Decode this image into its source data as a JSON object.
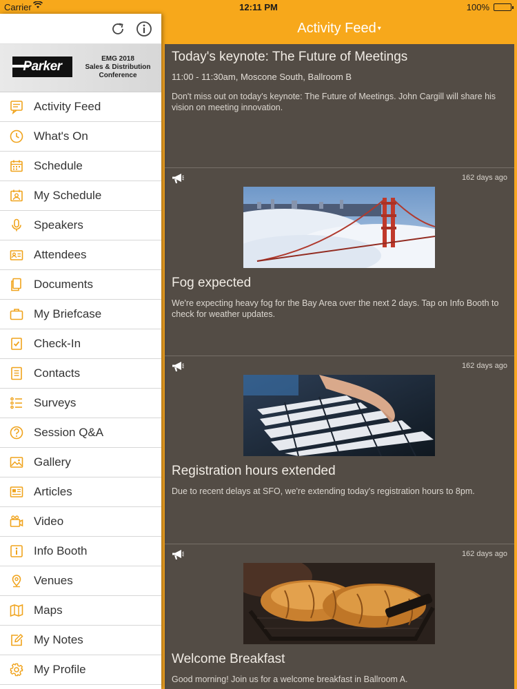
{
  "status_bar": {
    "carrier": "Carrier",
    "time": "12:11 PM",
    "battery": "100%",
    "battery_level": 1.0
  },
  "header": {
    "title": "Activity Feed",
    "caret": "▾"
  },
  "sidebar": {
    "toolbar": {
      "refresh_icon": "refresh-icon",
      "info_icon": "info-icon"
    },
    "banner": {
      "logo_text": "Parker",
      "line1": "EMG 2018",
      "line2": "Sales & Distribution",
      "line3": "Conference"
    },
    "items": [
      {
        "label": "Activity Feed",
        "icon": "feed-icon"
      },
      {
        "label": "What's On",
        "icon": "clock-icon"
      },
      {
        "label": "Schedule",
        "icon": "calendar-icon"
      },
      {
        "label": "My Schedule",
        "icon": "user-calendar-icon"
      },
      {
        "label": "Speakers",
        "icon": "microphone-icon"
      },
      {
        "label": "Attendees",
        "icon": "id-card-icon"
      },
      {
        "label": "Documents",
        "icon": "documents-icon"
      },
      {
        "label": "My Briefcase",
        "icon": "briefcase-icon"
      },
      {
        "label": "Check-In",
        "icon": "checkbox-icon"
      },
      {
        "label": "Contacts",
        "icon": "contacts-icon"
      },
      {
        "label": "Surveys",
        "icon": "list-icon"
      },
      {
        "label": "Session Q&A",
        "icon": "question-icon"
      },
      {
        "label": "Gallery",
        "icon": "image-icon"
      },
      {
        "label": "Articles",
        "icon": "newspaper-icon"
      },
      {
        "label": "Video",
        "icon": "video-icon"
      },
      {
        "label": "Info Booth",
        "icon": "info-box-icon"
      },
      {
        "label": "Venues",
        "icon": "location-pin-icon"
      },
      {
        "label": "Maps",
        "icon": "map-icon"
      },
      {
        "label": "My Notes",
        "icon": "pencil-icon"
      },
      {
        "label": "My Profile",
        "icon": "gear-icon"
      }
    ]
  },
  "feed": [
    {
      "title": "Today's keynote: The Future of Meetings",
      "subtitle": "11:00 - 11:30am, Moscone South, Ballroom B",
      "body": "Don't miss out on today's keynote: The Future of Meetings. John Cargill will share his vision on meeting innovation."
    },
    {
      "time_ago": "162 days ago",
      "image": "golden-gate-bridge-fog-photo",
      "title": "Fog expected",
      "body": "We're expecting heavy fog for the Bay Area over the next 2 days. Tap on Info Booth to check for weather updates."
    },
    {
      "time_ago": "162 days ago",
      "image": "keyboard-typing-photo",
      "title": "Registration hours extended",
      "body": "Due to recent delays at SFO, we're extending today's registration hours to 8pm."
    },
    {
      "time_ago": "162 days ago",
      "image": "croissants-basket-photo",
      "title": "Welcome Breakfast",
      "body": "Good morning! Join us for a welcome breakfast in Ballroom A."
    }
  ],
  "colors": {
    "accent": "#f7a81b",
    "feed_bg": "#534c45",
    "icon": "#f0a31c"
  }
}
